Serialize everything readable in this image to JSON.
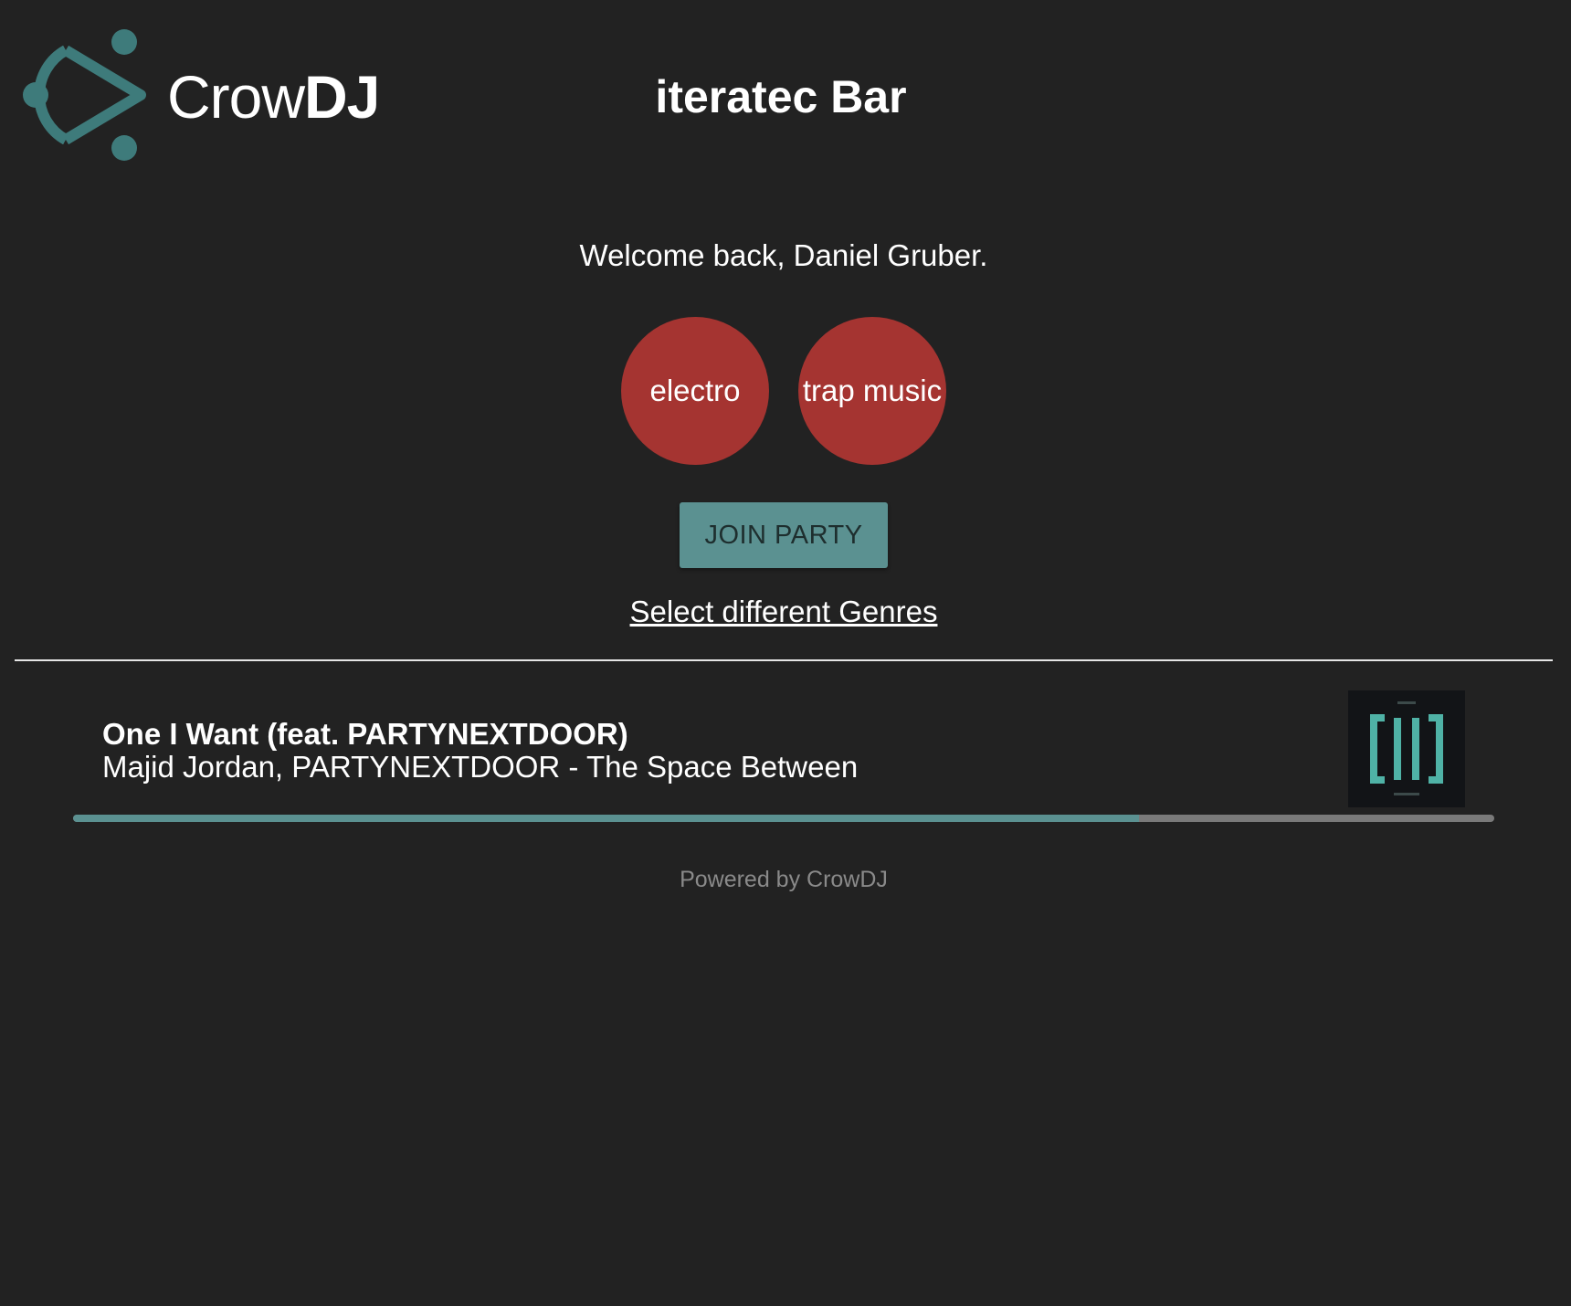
{
  "header": {
    "brand_light": "Crow",
    "brand_bold": "DJ",
    "venue": "iteratec Bar"
  },
  "welcome": "Welcome back, Daniel Gruber.",
  "genres": [
    "electro",
    "trap music"
  ],
  "join_label": "JOIN PARTY",
  "change_genres_label": "Select different Genres",
  "now_playing": {
    "title": "One I Want (feat. PARTYNEXTDOOR)",
    "subtitle": "Majid Jordan, PARTYNEXTDOOR - The Space Between",
    "progress": 0.75
  },
  "footer": "Powered by CrowDJ",
  "colors": {
    "background": "#222222",
    "accent": "#5b9191",
    "genre": "#a53431"
  }
}
